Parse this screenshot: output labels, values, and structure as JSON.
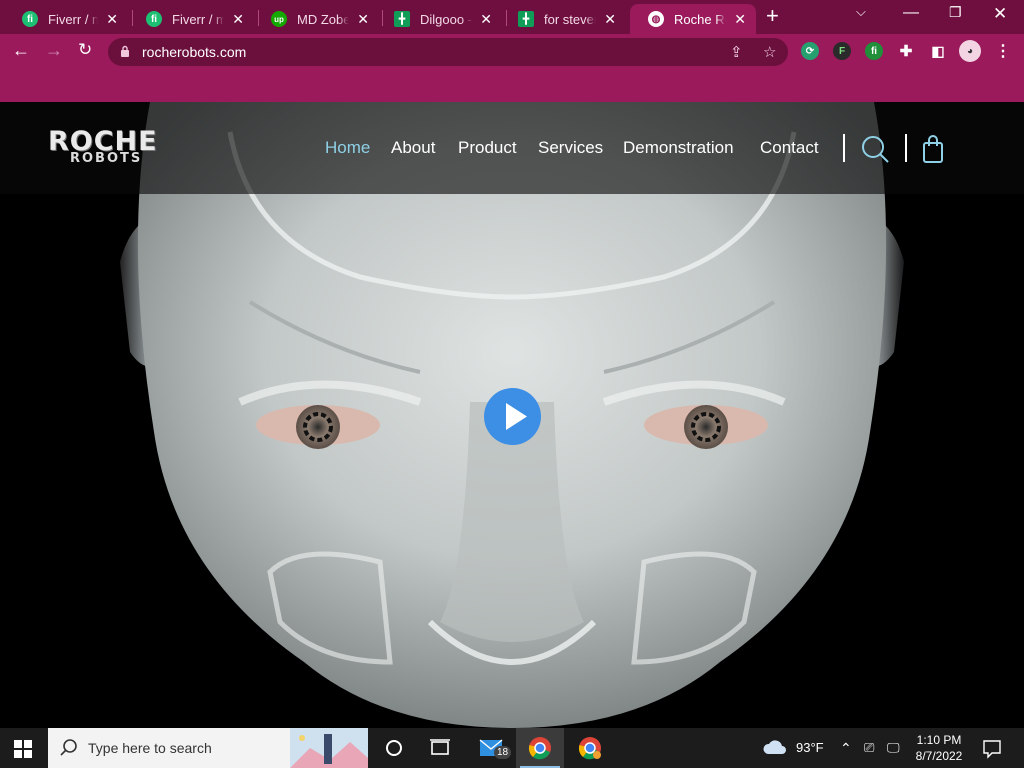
{
  "browser": {
    "tabs": [
      {
        "label": "Fiverr / mrk",
        "icon": "fiverr-icon",
        "color": "#1dbf73"
      },
      {
        "label": "Fiverr / mrk",
        "icon": "fiverr-icon",
        "color": "#1dbf73"
      },
      {
        "label": "MD Zobear",
        "icon": "upwork-icon",
        "color": "#14a800"
      },
      {
        "label": "Dilgooo - G",
        "icon": "sheets-icon",
        "color": "#0f9d58"
      },
      {
        "label": "for steveron",
        "icon": "sheets-icon",
        "color": "#0f9d58"
      },
      {
        "label": "Roche Robots",
        "icon": "globe-icon",
        "color": "#ffffff"
      }
    ],
    "url": "rocherobots.com",
    "accent": "#9a1a5b",
    "tabstrip_color": "#6e0f3f"
  },
  "site": {
    "logo": {
      "line1": "ROCHE",
      "line2": "ROBOTS"
    },
    "nav": [
      "Home",
      "About",
      "Product",
      "Services",
      "Demonstration",
      "Contact"
    ],
    "active_nav": "Home",
    "active_color": "#8fd0e6",
    "play_color": "#3d8ee5"
  },
  "taskbar": {
    "search_placeholder": "Type here to search",
    "mail_badge": "18",
    "weather": "93°F",
    "time": "1:10 PM",
    "date": "8/7/2022"
  }
}
